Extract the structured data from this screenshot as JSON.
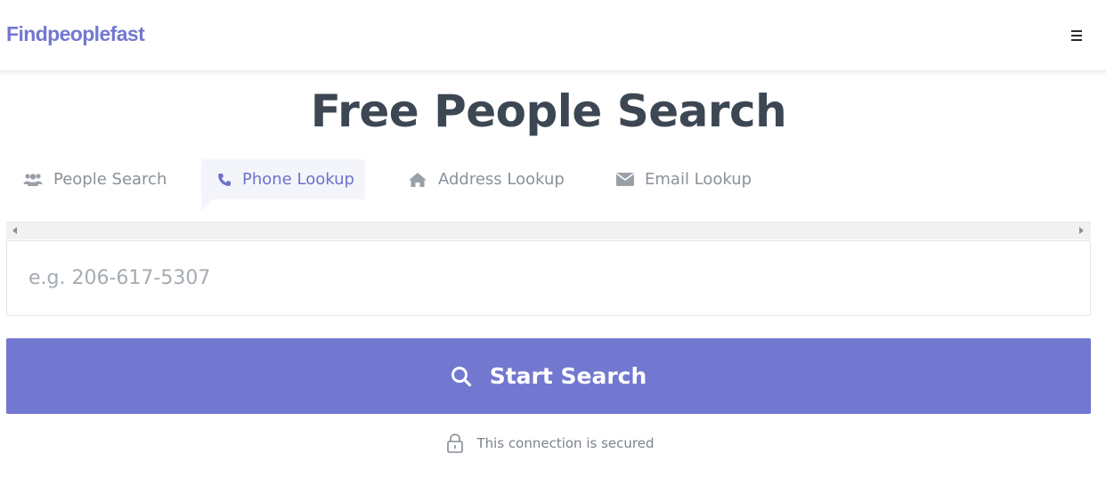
{
  "header": {
    "logo": "Findpeoplefast",
    "menu_icon": "hamburger-menu-icon"
  },
  "main": {
    "title": "Free People Search",
    "tabs": [
      {
        "label": "People Search",
        "icon": "people-icon",
        "active": false
      },
      {
        "label": "Phone Lookup",
        "icon": "phone-icon",
        "active": true
      },
      {
        "label": "Address Lookup",
        "icon": "home-icon",
        "active": false
      },
      {
        "label": "Email Lookup",
        "icon": "envelope-icon",
        "active": false
      }
    ],
    "search": {
      "placeholder": "e.g. 206-617-5307",
      "value": ""
    },
    "button": {
      "label": "Start Search",
      "icon": "search-icon"
    },
    "secure_note": {
      "text": "This connection is secured",
      "icon": "lock-icon"
    }
  },
  "colors": {
    "brand": "#7278d0",
    "active_tab_bg": "#f4f5fb",
    "title": "#3c4753",
    "muted": "#8a919a"
  }
}
